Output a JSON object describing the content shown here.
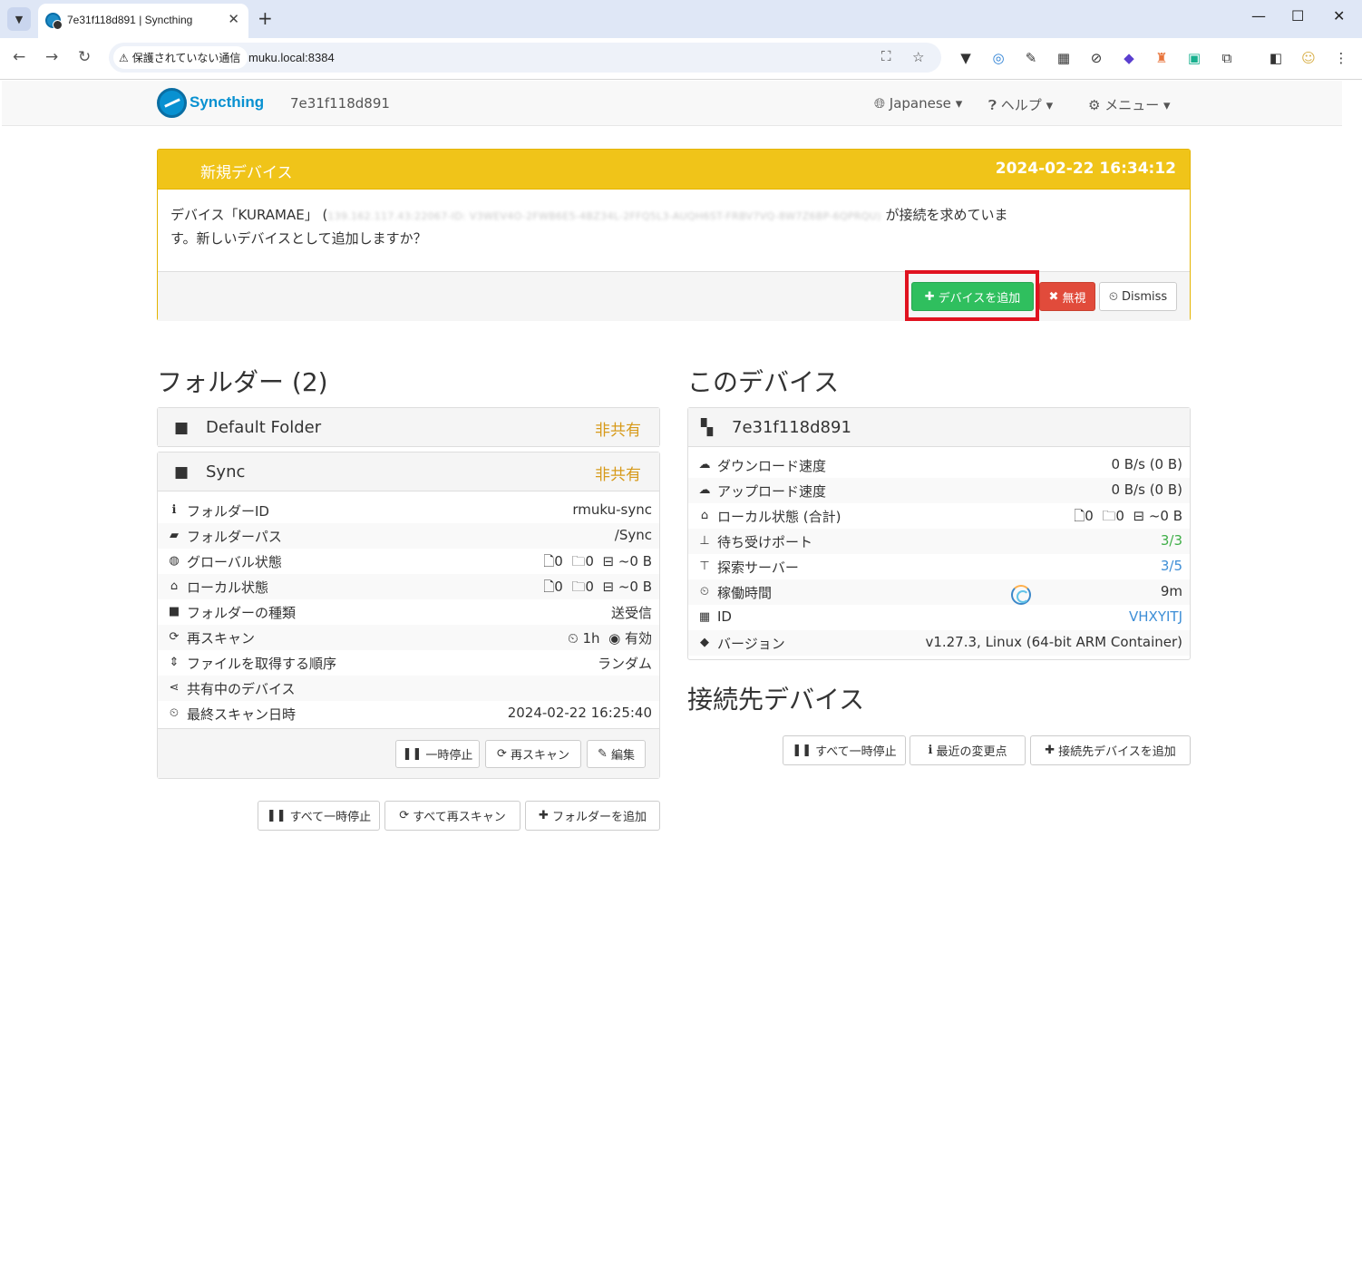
{
  "browser": {
    "tab_title": "7e31f118d891 | Syncthing",
    "tab_close": "✕",
    "new_tab": "+",
    "security_label": "保護されていない通信",
    "url": "muku.local:8384",
    "window_controls": {
      "minimize": "—",
      "maximize": "☐",
      "close": "✕"
    }
  },
  "navbar": {
    "brand": "Syncthing",
    "device_name": "7e31f118d891",
    "language_menu": "Japanese",
    "help_menu": "ヘルプ",
    "main_menu": "メニュー"
  },
  "notification": {
    "title": "新規デバイス",
    "timestamp": "2024-02-22 16:34:12",
    "message_prefix": "デバイス「KURAMAE」 (",
    "message_blurred": "139.162.117.43:22067-ID: V3WEV4O-2FWB6E5-4BZ34L-2FFQ5L3-AUQH6ST-FRBV7VQ-8W7Z6BP-6QPRQU)",
    "message_suffix": " が接続を求めていま",
    "message_line2": "す。新しいデバイスとして追加しますか？",
    "add_button": "デバイスを追加",
    "ignore_button": "無視",
    "dismiss_button": "Dismiss"
  },
  "folders": {
    "section_title": "フォルダー (2)",
    "default_folder": {
      "name": "Default Folder",
      "status": "非共有"
    },
    "sync_folder": {
      "name": "Sync",
      "status": "非共有",
      "rows": {
        "folder_id": {
          "label": "フォルダーID",
          "value": "rmuku-sync"
        },
        "folder_path": {
          "label": "フォルダーパス",
          "value": "/Sync"
        },
        "global_state": {
          "label": "グローバル状態",
          "files": "0",
          "dirs": "0",
          "size": "~0 B"
        },
        "local_state": {
          "label": "ローカル状態",
          "files": "0",
          "dirs": "0",
          "size": "~0 B"
        },
        "folder_type": {
          "label": "フォルダーの種類",
          "value": "送受信"
        },
        "rescan": {
          "label": "再スキャン",
          "interval": "1h",
          "watch": "有効"
        },
        "pull_order": {
          "label": "ファイルを取得する順序",
          "value": "ランダム"
        },
        "shared_with": {
          "label": "共有中のデバイス",
          "value": ""
        },
        "last_scan": {
          "label": "最終スキャン日時",
          "value": "2024-02-22 16:25:40"
        }
      },
      "pause_button": "一時停止",
      "rescan_button": "再スキャン",
      "edit_button": "編集"
    },
    "pause_all_button": "すべて一時停止",
    "rescan_all_button": "すべて再スキャン",
    "add_folder_button": "フォルダーを追加"
  },
  "this_device": {
    "section_title": "このデバイス",
    "name": "7e31f118d891",
    "rows": {
      "download_rate": {
        "label": "ダウンロード速度",
        "value": "0 B/s (0 B)"
      },
      "upload_rate": {
        "label": "アップロード速度",
        "value": "0 B/s (0 B)"
      },
      "local_state_total": {
        "label": "ローカル状態 (合計)",
        "files": "0",
        "dirs": "0",
        "size": "~0 B"
      },
      "listeners": {
        "label": "待ち受けポート",
        "value": "3/3"
      },
      "discovery": {
        "label": "探索サーバー",
        "value": "3/5"
      },
      "uptime": {
        "label": "稼働時間",
        "value": "9m"
      },
      "id": {
        "label": "ID",
        "value": "VHXYITJ"
      },
      "version": {
        "label": "バージョン",
        "value": "v1.27.3, Linux (64-bit ARM Container)"
      }
    }
  },
  "remote_devices": {
    "section_title": "接続先デバイス",
    "pause_all_button": "すべて一時停止",
    "recent_changes_button": "最近の変更点",
    "add_device_button": "接続先デバイスを追加"
  },
  "colors": {
    "accent": "#0891d1",
    "notice_header": "#f0c419",
    "success": "#2fbf5e",
    "danger": "#e14b3b",
    "unshared": "#d79a1a",
    "link": "#3d8ed6",
    "highlight": "#e0121f"
  },
  "icons": {
    "folder": "folder-icon",
    "info": "info-icon",
    "globe": "globe-icon",
    "home": "home-icon",
    "refresh": "refresh-icon",
    "sort": "sort-icon",
    "share": "share-icon",
    "clock": "clock-icon",
    "cloud_down": "cloud-download-icon",
    "cloud_up": "cloud-upload-icon",
    "network": "network-icon",
    "signpost": "signpost-icon",
    "qrcode": "qrcode-icon",
    "tag": "tag-icon"
  }
}
